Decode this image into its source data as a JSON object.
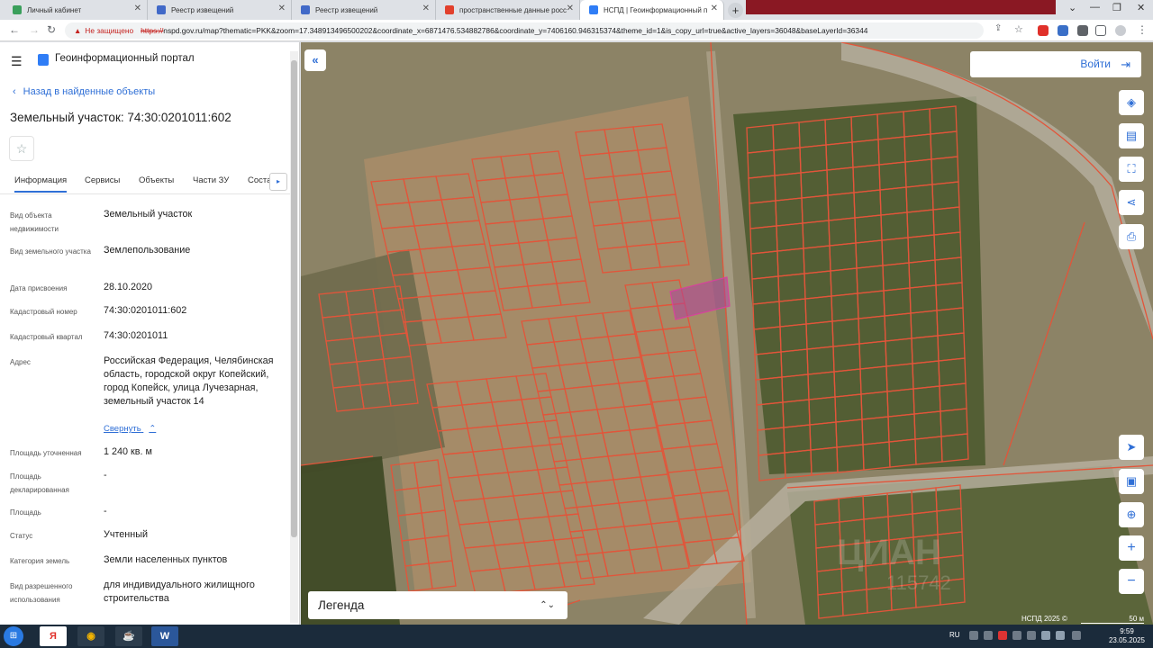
{
  "browser": {
    "tabs": [
      {
        "title": "Личный кабинет",
        "fav_color": "#3a9f5b"
      },
      {
        "title": "Реестр извещений",
        "fav_color": "#4169c8"
      },
      {
        "title": "Реестр извещений",
        "fav_color": "#4169c8"
      },
      {
        "title": "пространственные данные росс",
        "fav_color": "#e2402c"
      },
      {
        "title": "НСПД | Геоинформационный п",
        "fav_color": "#2f7df6"
      }
    ],
    "tab_close": "✕",
    "new_tab": "+",
    "not_secure": "Не защищено",
    "url_scheme": "https://",
    "url_rest": "nspd.gov.ru/map?thematic=PKK&zoom=17.348913496500202&coordinate_x=6871476.534882786&coordinate_y=7406160.946315374&theme_id=1&is_copy_url=true&active_layers=36048&baseLayerId=36344"
  },
  "header": {
    "menu_icon": "☰",
    "app_title": "Геоинформационный портал"
  },
  "panel": {
    "back_link": "Назад в найденные объекты",
    "title": "Земельный участок: 74:30:0201011:602",
    "favorite_icon": "☆",
    "tabs": [
      "Информация",
      "Сервисы",
      "Объекты",
      "Части ЗУ",
      "Состав"
    ],
    "tab_scroll_icon": "▸",
    "attributes": [
      {
        "label": "Вид объекта недвижимости",
        "value": "Земельный участок"
      },
      {
        "label": "Вид земельного участка",
        "value": "Землепользование"
      },
      {
        "label": "Дата присвоения",
        "value": "28.10.2020"
      },
      {
        "label": "Кадастровый номер",
        "value": "74:30:0201011:602"
      },
      {
        "label": "Кадастровый квартал",
        "value": "74:30:0201011"
      },
      {
        "label": "Адрес",
        "value": "Российская Федерация, Челябинская область, городской округ Копейский, город Копейск, улица Лучезарная, земельный участок 14"
      },
      {
        "label": "Площадь уточненная",
        "value": "1 240 кв. м"
      },
      {
        "label": "Площадь декларированная",
        "value": "-"
      },
      {
        "label": "Площадь",
        "value": "-"
      },
      {
        "label": "Статус",
        "value": "Учтенный"
      },
      {
        "label": "Категория земель",
        "value": "Земли населенных пунктов"
      },
      {
        "label": "Вид разрешенного использования",
        "value": "для индивидуального жилищного строительства"
      }
    ],
    "collapse_link": "Свернуть"
  },
  "map": {
    "collapse_icon": "«",
    "login_label": "Войти",
    "login_icon": "⇥",
    "tools": [
      {
        "name": "layers-icon",
        "glyph": "◈"
      },
      {
        "name": "ruler-icon",
        "glyph": "▤"
      },
      {
        "name": "select-area-icon",
        "glyph": "⛶"
      },
      {
        "name": "share-icon",
        "glyph": "⋖"
      },
      {
        "name": "print-icon",
        "glyph": "⎙"
      },
      {
        "name": "navigate-icon",
        "glyph": "➤"
      },
      {
        "name": "minimap-icon",
        "glyph": "▣"
      },
      {
        "name": "locate-icon",
        "glyph": "⊕"
      },
      {
        "name": "zoom-in-icon",
        "glyph": "+"
      },
      {
        "name": "zoom-out-icon",
        "glyph": "−"
      }
    ],
    "legend_label": "Легенда",
    "legend_caret": "⌃⌄",
    "attribution": "НСПД 2025 ©",
    "scale": "50 м",
    "watermark": "ЦИАН",
    "watermark_id": "115742",
    "parcel_color": "#e2553a",
    "selected_color": "#b0429a"
  },
  "taskbar": {
    "lang": "RU",
    "time": "9:59",
    "date": "23.05.2025",
    "apps": [
      {
        "name": "yandex-browser-app",
        "glyph": "Я",
        "color": "#ffffff",
        "text": "#e0302a"
      },
      {
        "name": "chrome-app",
        "glyph": "◉",
        "color": "#2c3c4c",
        "text": "#f4b400"
      },
      {
        "name": "java-app",
        "glyph": "☕",
        "color": "#2c3c4c",
        "text": "#e97b1c"
      },
      {
        "name": "word-app",
        "glyph": "W",
        "color": "#2b579a",
        "text": "#ffffff"
      }
    ]
  }
}
